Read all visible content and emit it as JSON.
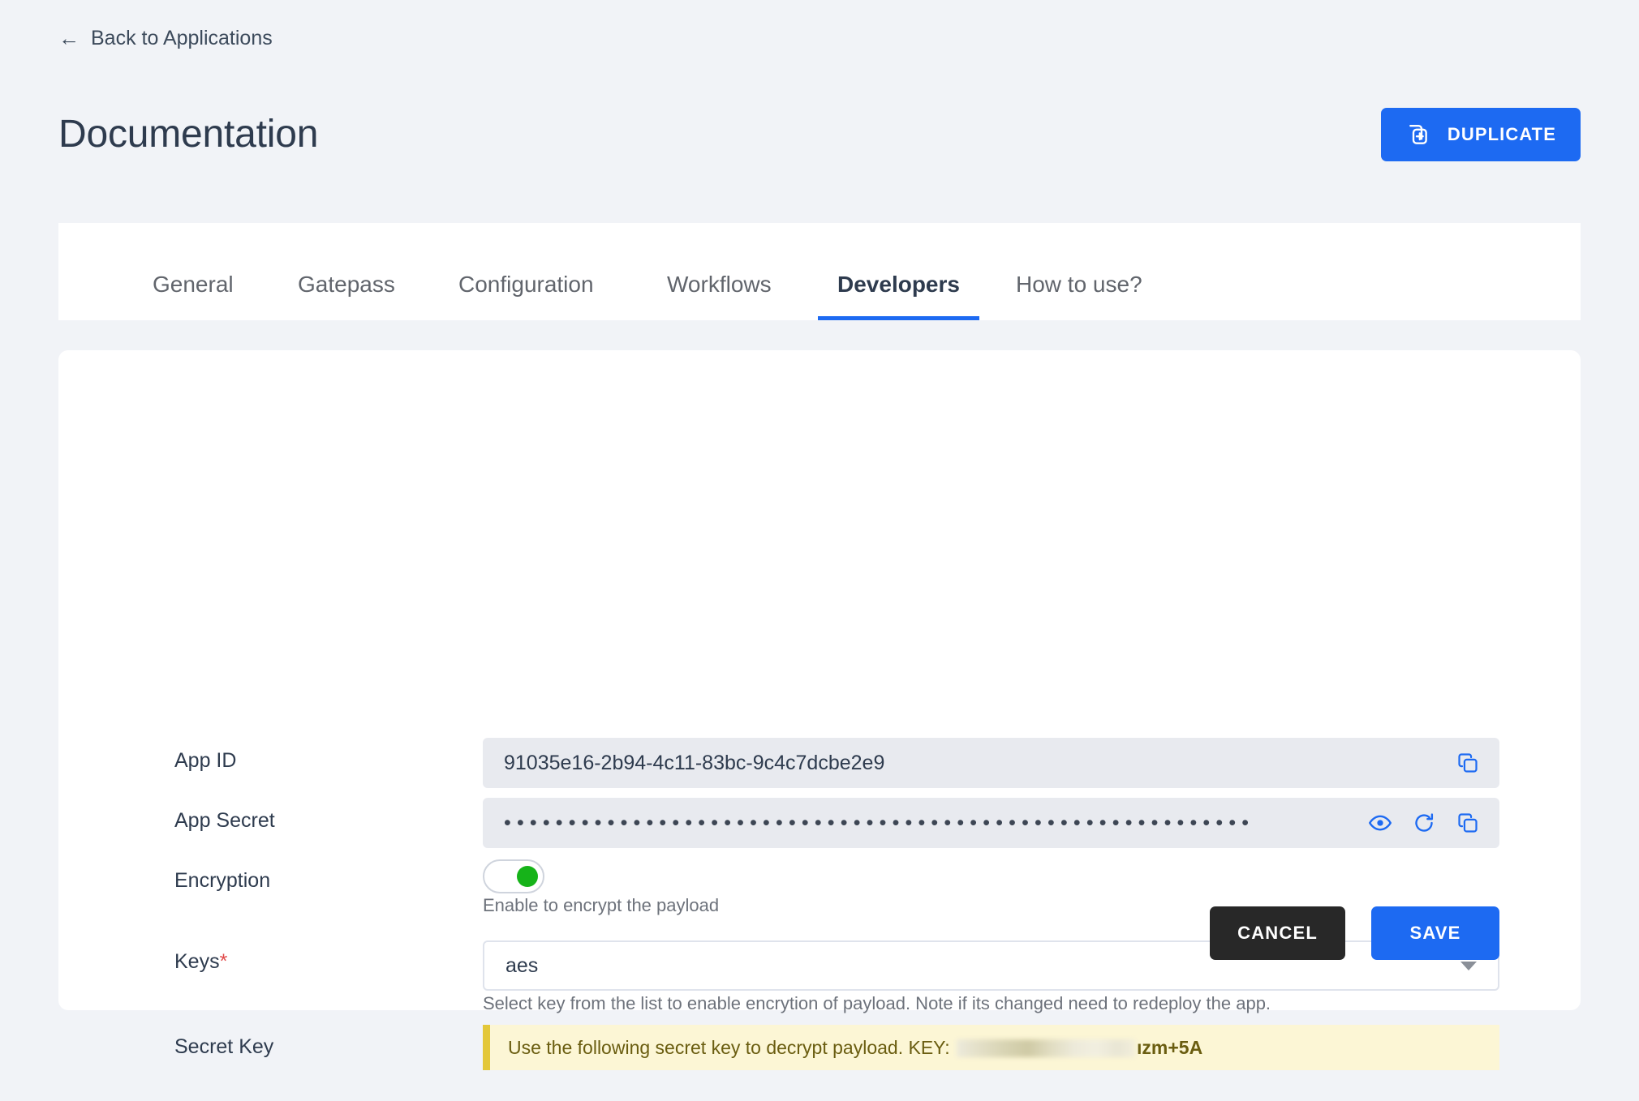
{
  "header": {
    "back_link": "Back to Applications",
    "back_icon": "arrow-left-icon",
    "title": "Documentation",
    "duplicate_label": "DUPLICATE",
    "duplicate_icon": "duplicate-plus-icon"
  },
  "tabs": [
    {
      "label": "General",
      "active": false
    },
    {
      "label": "Gatepass",
      "active": false
    },
    {
      "label": "Configuration",
      "active": false
    },
    {
      "label": "Workflows",
      "active": false
    },
    {
      "label": "Developers",
      "active": true
    },
    {
      "label": "How to use?",
      "active": false
    }
  ],
  "form": {
    "app_id": {
      "label": "App ID",
      "value": "91035e16-2b94-4c11-83bc-9c4c7dcbe2e9",
      "copy_icon": "copy-icon"
    },
    "app_secret": {
      "label": "App Secret",
      "masked_value": "••••••••••••••••••••••••••••••••••••••••••••••••••••••••••",
      "reveal_icon": "eye-icon",
      "regenerate_icon": "refresh-icon",
      "copy_icon": "copy-icon"
    },
    "encryption": {
      "label": "Encryption",
      "enabled": true,
      "helper": "Enable to encrypt the payload"
    },
    "keys": {
      "label": "Keys",
      "required_marker": "*",
      "selected": "aes",
      "helper": "Select key from the list to enable encrytion of payload. Note if its changed need to redeploy the app.",
      "caret_icon": "chevron-down-icon"
    },
    "secret_key": {
      "label": "Secret Key",
      "banner_prefix": "Use the following secret key to decrypt payload. KEY:",
      "banner_key_visible_tail": "ızm+5A"
    }
  },
  "actions": {
    "cancel_label": "CANCEL",
    "save_label": "SAVE"
  },
  "colors": {
    "accent_blue": "#1d6af2",
    "toggle_green": "#16b319",
    "banner_bg": "#fcf6d5",
    "banner_bar": "#e3c739",
    "page_bg": "#f1f3f7",
    "required_red": "#e04a4a"
  }
}
